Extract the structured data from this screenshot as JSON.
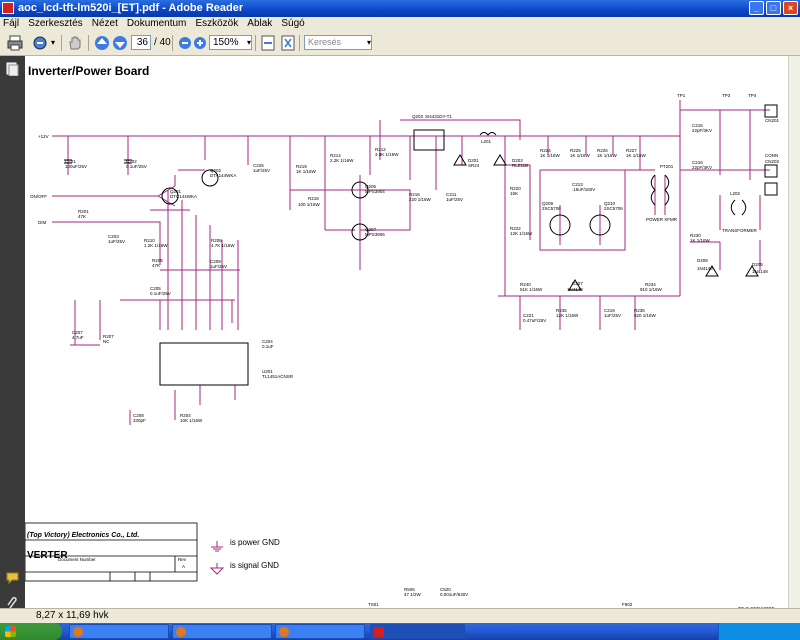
{
  "window": {
    "title": "aoc_lcd-tft-lm520i_[ET].pdf - Adobe Reader"
  },
  "menu": [
    "Fájl",
    "Szerkesztés",
    "Nézet",
    "Dokumentum",
    "Eszközök",
    "Ablak",
    "Súgó"
  ],
  "toolbar": {
    "page_current": "36",
    "page_sep": "/",
    "page_total": "40",
    "zoom": "150%",
    "search_placeholder": "Keresés"
  },
  "status": {
    "page_size": "8,27 x 11,69 hvk"
  },
  "doc": {
    "heading": "Inverter/Power Board",
    "company": "(Top Victory) Electronics Co., Ltd.",
    "doc_number_label": "Document Number",
    "rev_label": "Rev",
    "rev_value": "A",
    "title_block": "VERTER",
    "power_gnd": "is power GND",
    "signal_gnd": "is signal GND"
  },
  "schematic_labels": {
    "v12": "+12V",
    "onoff": "ON/OFF",
    "dim": "DIM",
    "q203": "Q203",
    "q203p": "SI4431DY-T1",
    "l201": "L201",
    "c201": "C201",
    "c201v": "100uF/25V",
    "c202": "C202",
    "c202v": "0.1uF/25V",
    "q201": "Q201",
    "q201p": "DTC144WKA",
    "q202": "Q202",
    "q202p": "DTA144WKA",
    "c225": "C225",
    "c225v": "1uF/25V",
    "r219": "R219",
    "r219v": "1K 1/16W",
    "r214": "R214",
    "r214v": "2.2K 1/16W",
    "r212": "R212",
    "r212v": "3.9K 1/16W",
    "d201": "D201",
    "d201p": "SR24",
    "d203": "D203",
    "d203p": "RLZ11B",
    "r224": "R224",
    "r224v": "1K 1/16W",
    "r225": "R225",
    "r225v": "1K 1/16W",
    "r226": "R226",
    "r226v": "1K 1/16W",
    "r227": "R227",
    "r227v": "1K 1/16W",
    "tp1": "TP1",
    "tp3": "TP3",
    "tp4": "TP4",
    "c215": "C215",
    "c215v": "22pF/3KV",
    "cn201": "CN201",
    "cn202": "CN202",
    "conn": "CONN",
    "c216": "C216",
    "c216v": "22pF/3KV",
    "q205": "Q205",
    "q205p": "MPS3904",
    "r216": "R216",
    "r216v": "220 1/16W",
    "c211": "C211",
    "c211v": "1uF/25V",
    "r220": "R220",
    "r220v": "15K",
    "c213": "C213",
    "c213v": ".15uF/160V",
    "pt201": "PT201",
    "l202": "L202",
    "r201": "R201",
    "r201v": "47K",
    "r218": "R218",
    "r218v": "100 1/16W",
    "q209": "Q209",
    "q209p": "2SC5706",
    "q210": "Q210",
    "q210p": "2SC5706",
    "powerxfmr": "POWER XFMR",
    "transformer": "TRANSFORMER",
    "c203": "C203",
    "c203v": "1uF/25V",
    "r210": "R210",
    "r210v": "1.2K 1/16W",
    "r208": "R208",
    "r208v": "4.7K 1/16W",
    "q207": "Q207",
    "q207p": "MPS3906",
    "r222": "R222",
    "r222v": "12K 1/16W",
    "r230": "R230",
    "r230v": "1K 1/16W",
    "c209": "C209",
    "c209v": "1uF/25V",
    "r205": "R205",
    "r205v": "47K",
    "d209": "D209",
    "d209p": "1N4148",
    "d205": "D205",
    "d205p": "1N4148",
    "c205": "C205",
    "c205v": "0.1uF/25V",
    "r240": "R240",
    "r240v": "51K 1/16W",
    "d207": "D207",
    "d207p": "1N4148",
    "r234": "R234",
    "r234v": "910 1/16W",
    "c207": "C207",
    "c207v": "4.7uF",
    "r207": "R207",
    "r207v": "NC",
    "c221": "C221",
    "c221v": "0.47uF/25V",
    "r235": "R235",
    "r235v": "12K 1/16W",
    "c219": "C219",
    "c219v": "1uF/25V",
    "r236": "R236",
    "r236v": "820 1/16W",
    "c204": "C204",
    "c204v": "0.1uF",
    "u201": "U201",
    "u201p": "TL1451ACNSR",
    "c208": "C208",
    "c208v": "330pF",
    "r204": "R204",
    "r204v": "10K 1/16W",
    "r505": "R505",
    "r505v": "47 1/2W",
    "c520": "C520",
    "c520v": "0.001uF/630V",
    "ts01": "TS01",
    "f902": "F902",
    "bottom_right": "TO SLEEP MODE"
  }
}
